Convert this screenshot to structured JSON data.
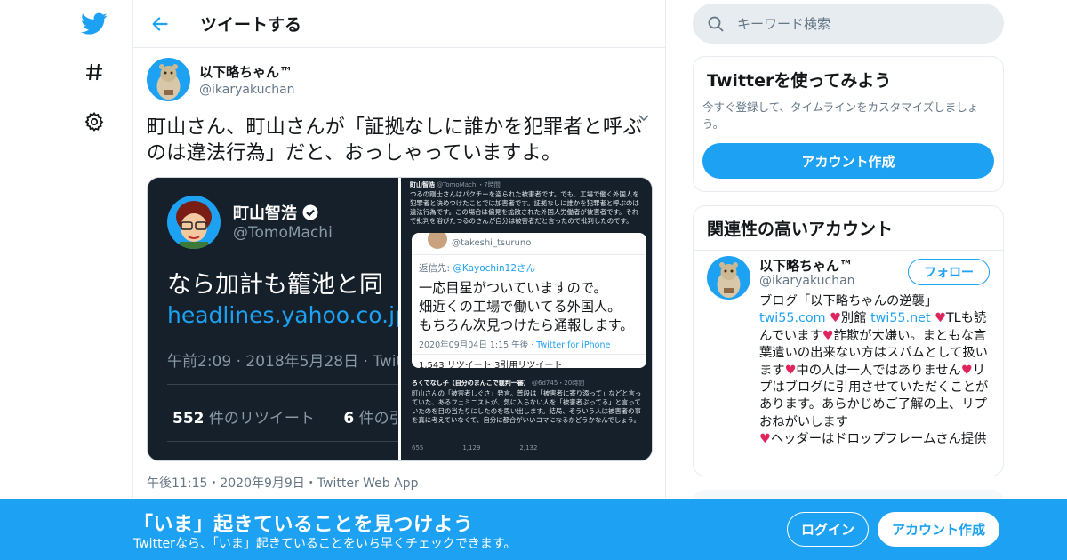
{
  "nav": {
    "icons": [
      "twitter-bird-icon",
      "hashtag-icon",
      "gear-icon"
    ]
  },
  "colors": {
    "accent": "#1da1f2",
    "heart": "#e0245e",
    "text": "#14171a",
    "muted": "#657786"
  },
  "header": {
    "title": "ツイートする"
  },
  "tweet": {
    "display_name": "以下略ちゃん™",
    "handle": "@ikaryakuchan",
    "text": "町山さん、町山さんが「証拠なしに誰かを犯罪者と呼ぶのは違法行為」だと、おっしゃっていますよ。",
    "meta": "午後11:15・2020年9月9日・Twitter Web App"
  },
  "media_left": {
    "name": "町山智浩",
    "handle": "@TomoMachi",
    "text": "なら加計も籠池と同",
    "link": "headlines.yahoo.co.jp",
    "time": "午前2:09 · 2018年5月28日 · Twit",
    "rt_count": "552",
    "rt_label": "件のリツイート",
    "like_count": "6",
    "like_label": "件の引"
  },
  "media_right": {
    "head_name": "町山智浩",
    "head_rest": "@TomoMachi・7時間",
    "body": "つるの剛士さんはパクチーを盗られた被害者です。でも、工場で働く外国人を犯罪者と決めつけたことでは加害者です。証拠なしに誰かを犯罪者と呼ぶのは違法行為です。この場合は偏見を拡散された外国人労働者が被害者です。それで批判を浴びたつるのさんが自分は被害者だと言ったので批判したのです。",
    "card_handle": "@takeshi_tsuruno",
    "reply_prefix": "返信先: ",
    "reply_to": "@Kayochin12さん",
    "card_lines": [
      "一応目星がついていますので。",
      "畑近くの工場で働いてる外国人。",
      "もちろん次見つけたら通報します。"
    ],
    "card_date": "2020年09月04日 1:15 午後 · ",
    "card_source": "Twitter for iPhone",
    "card_rt": "1,543 リツイート 3引用リツイート",
    "reply2_name": "ろくでなし子（自分のまんこで裁判一審）",
    "reply2_rest": "@6d745・20時間",
    "reply2_body": "町山さんの「被害者しぐさ」発言。普段は「被害者に寄り添って」などと言っていた、あるフェミニストが、気に入らない人を「被害者ぶってる」と言っていたのを目の当たりにしたのを思い出します。結局、そういう人は被害者の事を真に考えていなくて、自分に都合がいいコマになるかどうかなんでしょう。",
    "actions": [
      "655",
      "1,129",
      "2,132"
    ]
  },
  "search": {
    "placeholder": "キーワード検索"
  },
  "signup_box": {
    "title": "Twitterを使ってみよう",
    "subtitle": "今すぐ登録して、タイムラインをカスタマイズしましょう。",
    "button": "アカウント作成"
  },
  "related": {
    "title": "関連性の高いアカウント",
    "name": "以下略ちゃん™",
    "handle": "@ikaryakuchan",
    "follow": "フォロー",
    "bio": {
      "p1": "ブログ「以下略ちゃんの逆襲」",
      "link1": "twi55.com",
      "p2": "別館 ",
      "link2": "twi55.net",
      "p3": "TLも読んでいます",
      "p4": "詐欺が大嫌い。まともな言葉遣いの出来ない方はスパムとして扱います",
      "p5": "中の人は一人ではありません",
      "p6": "リプはブログに引用させていただくことがあります。あらかじめご了解の上、リプおねがいします",
      "p7": "ヘッダーはドロップフレームさん提供"
    }
  },
  "banner": {
    "title": "「いま」起きていることを見つけよう",
    "subtitle": "Twitterなら、「いま」起きていることをいち早くチェックできます。",
    "login": "ログイン",
    "signup": "アカウント作成"
  }
}
